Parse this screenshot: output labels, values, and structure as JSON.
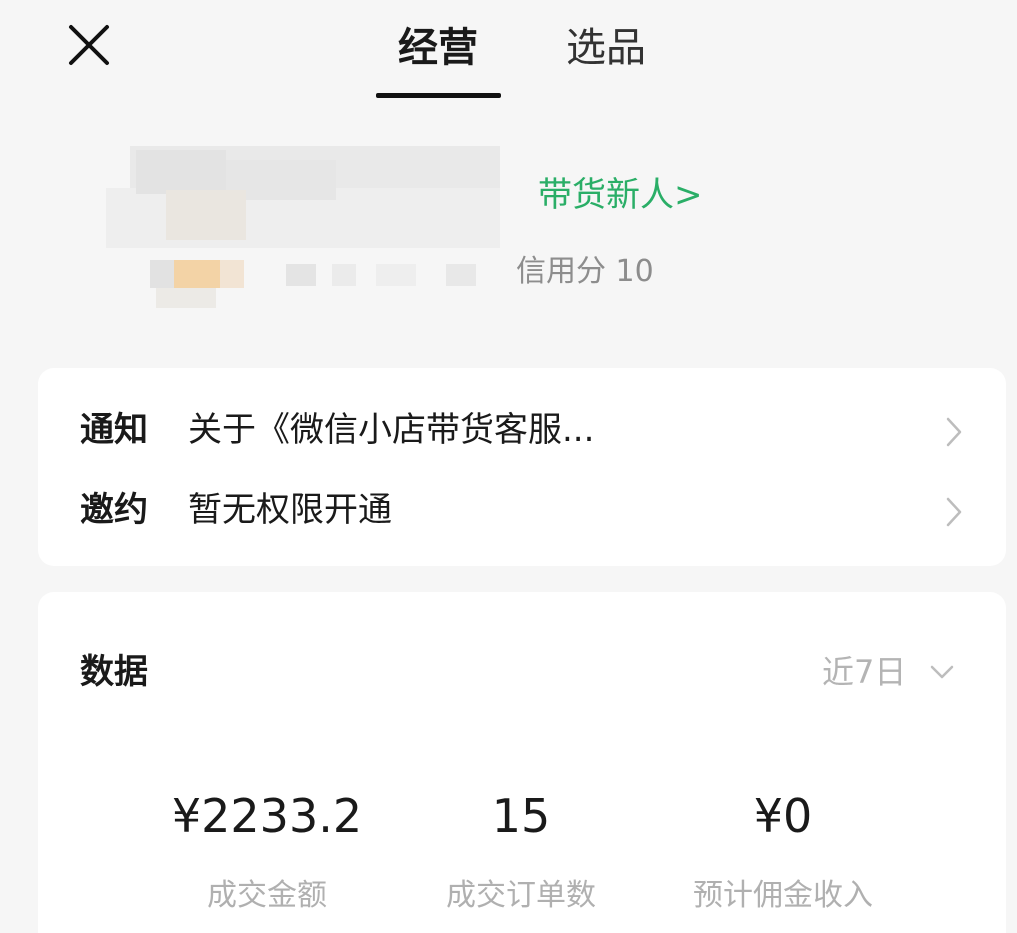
{
  "header": {
    "tabs": [
      {
        "label": "经营",
        "active": true
      },
      {
        "label": "选品",
        "active": false
      }
    ]
  },
  "profile": {
    "level_tag": "带货新人>",
    "credit_text": "信用分 10"
  },
  "notices": [
    {
      "label": "通知",
      "value": "关于《微信小店带货客服..."
    },
    {
      "label": "邀约",
      "value": "暂无权限开通"
    }
  ],
  "data_section": {
    "title": "数据",
    "range": "近7日",
    "metrics": [
      {
        "value": "¥2233.2",
        "caption": "成交金额"
      },
      {
        "value": "15",
        "caption": "成交订单数"
      },
      {
        "value": "¥0",
        "caption": "预计佣金收入"
      }
    ]
  },
  "colors": {
    "accent_green": "#2aae67",
    "background": "#f6f6f6",
    "card": "#ffffff",
    "muted_text": "#b0b0b0"
  },
  "icons": {
    "close": "close-icon",
    "chevron_right": "chevron-right-icon",
    "chevron_down": "chevron-down-icon"
  }
}
